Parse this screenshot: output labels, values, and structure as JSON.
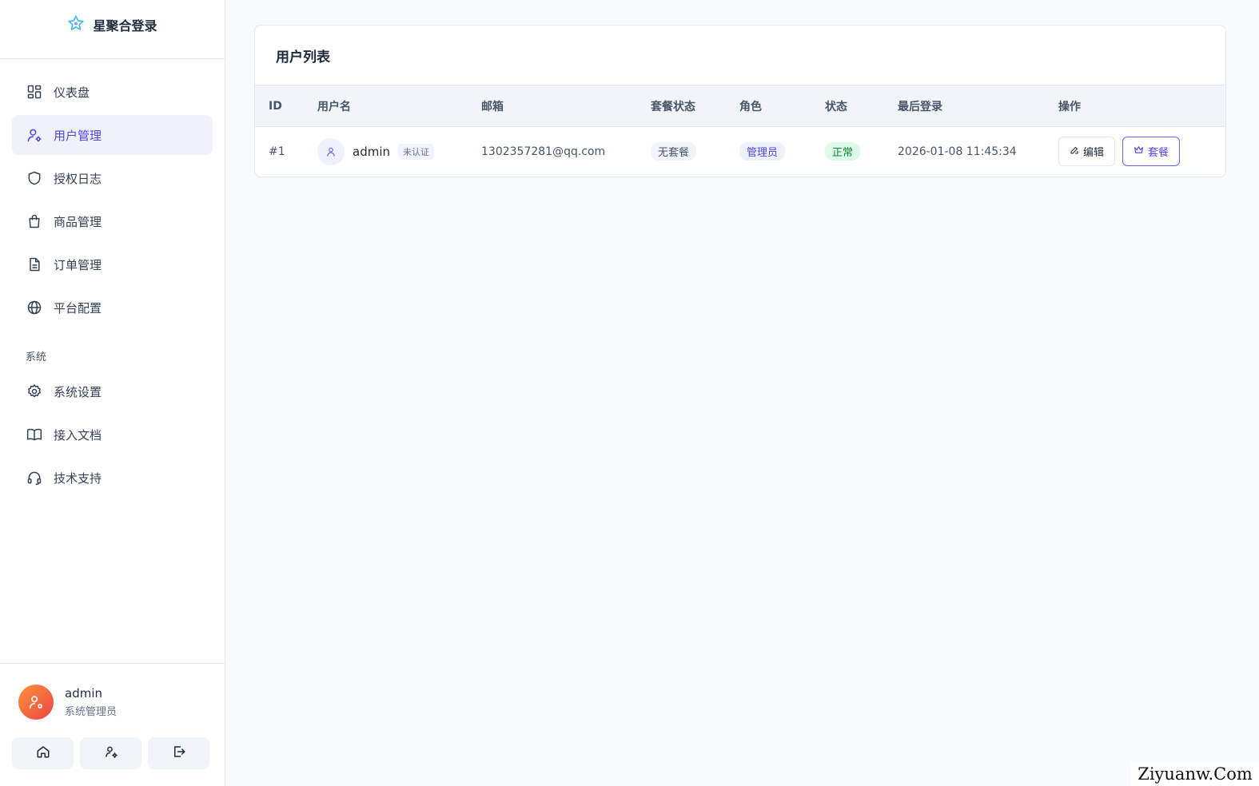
{
  "brand": {
    "name": "星聚合登录",
    "icon": "star-icon"
  },
  "sidebar": {
    "items": [
      {
        "label": "仪表盘",
        "icon": "dashboard-icon",
        "active": false
      },
      {
        "label": "用户管理",
        "icon": "user-cog-icon",
        "active": true
      },
      {
        "label": "授权日志",
        "icon": "shield-icon",
        "active": false
      },
      {
        "label": "商品管理",
        "icon": "shopping-bag-icon",
        "active": false
      },
      {
        "label": "订单管理",
        "icon": "document-icon",
        "active": false
      },
      {
        "label": "平台配置",
        "icon": "globe-icon",
        "active": false
      }
    ],
    "section_label": "系统",
    "system_items": [
      {
        "label": "系统设置",
        "icon": "gear-icon"
      },
      {
        "label": "接入文档",
        "icon": "book-icon"
      },
      {
        "label": "技术支持",
        "icon": "headset-icon"
      }
    ]
  },
  "current_user": {
    "name": "admin",
    "role": "系统管理员"
  },
  "bottom_actions": [
    "home-icon",
    "user-settings-icon",
    "logout-icon"
  ],
  "main": {
    "card_title": "用户列表",
    "table": {
      "headers": [
        "ID",
        "用户名",
        "邮箱",
        "套餐状态",
        "角色",
        "状态",
        "最后登录",
        "操作"
      ],
      "rows": [
        {
          "id": "#1",
          "username": "admin",
          "verify_badge": "未认证",
          "email": "1302357281@qq.com",
          "plan_status": "无套餐",
          "role": "管理员",
          "status": "正常",
          "last_login": "2026-01-08 11:45:34",
          "edit_label": "编辑",
          "plan_label": "套餐"
        }
      ]
    }
  },
  "colors": {
    "accent": "#4f46e5",
    "success": "#15803d",
    "avatar_gradient_start": "#fb923c",
    "avatar_gradient_end": "#ef4444"
  },
  "watermark": "Ziyuanw.Com"
}
